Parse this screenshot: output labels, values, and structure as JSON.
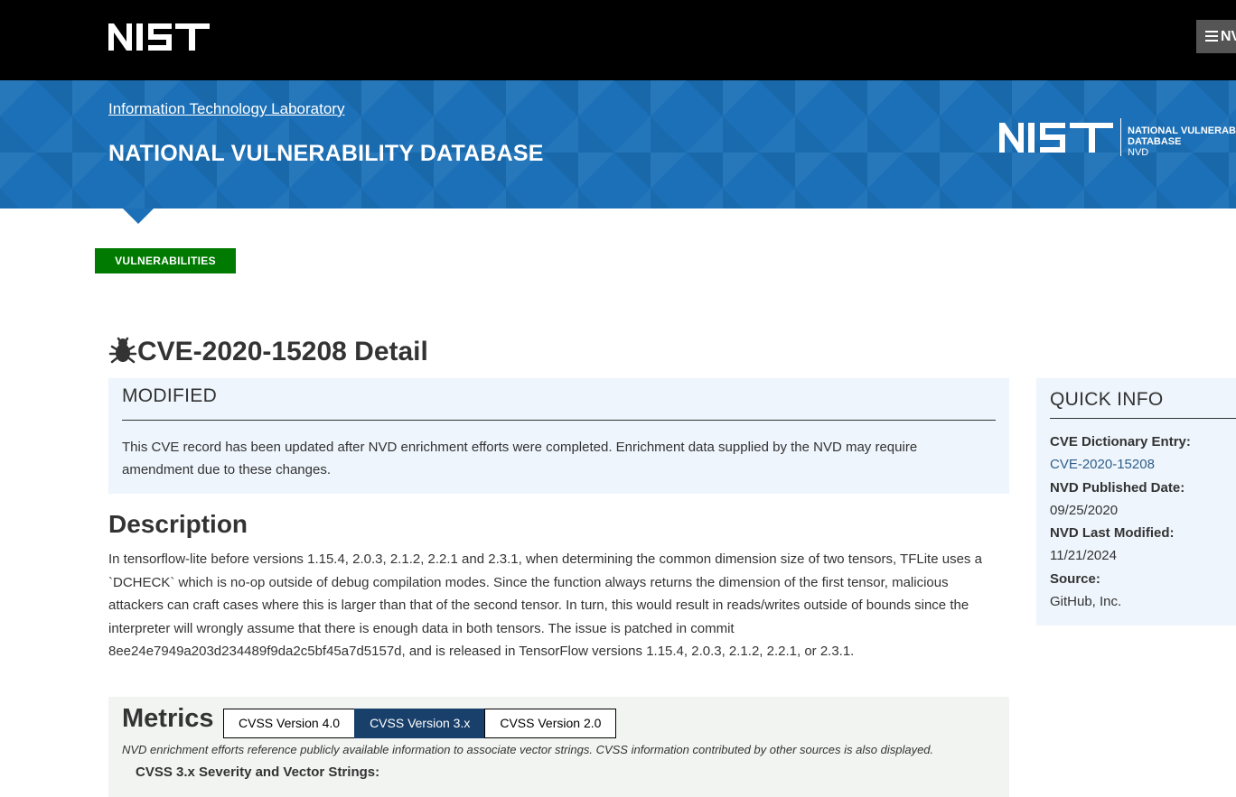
{
  "header": {
    "logo_text": "NIST",
    "menu_label": "NV",
    "menu_icon": "hamburger-icon"
  },
  "banner": {
    "lab_link": "Information Technology Laboratory",
    "title": "NATIONAL VULNERABILITY DATABASE",
    "logo": {
      "mark": "NIST",
      "line1": "NATIONAL VULNERABI",
      "line2": "DATABASE",
      "line3": "NVD"
    }
  },
  "nav": {
    "vulnerabilities_button": "VULNERABILITIES"
  },
  "page": {
    "icon": "bug-icon",
    "title": "CVE-2020-15208 Detail"
  },
  "modified": {
    "title": "MODIFIED",
    "text": "This CVE record has been updated after NVD enrichment efforts were completed. Enrichment data supplied by the NVD may require amendment due to these changes."
  },
  "description": {
    "heading": "Description",
    "text": "In tensorflow-lite before versions 1.15.4, 2.0.3, 2.1.2, 2.2.1 and 2.3.1, when determining the common dimension size of two tensors, TFLite uses a `DCHECK` which is no-op outside of debug compilation modes. Since the function always returns the dimension of the first tensor, malicious attackers can craft cases where this is larger than that of the second tensor. In turn, this would result in reads/writes outside of bounds since the interpreter will wrongly assume that there is enough data in both tensors. The issue is patched in commit 8ee24e7949a203d234489f9da2c5bf45a7d5157d, and is released in TensorFlow versions 1.15.4, 2.0.3, 2.1.2, 2.2.1, or 2.3.1."
  },
  "metrics": {
    "heading": "Metrics",
    "tabs": [
      {
        "label": "CVSS Version 4.0",
        "active": false
      },
      {
        "label": "CVSS Version 3.x",
        "active": true
      },
      {
        "label": "CVSS Version 2.0",
        "active": false
      }
    ],
    "note": "NVD enrichment efforts reference publicly available information to associate vector strings. CVSS information contributed by other sources is also displayed.",
    "subheading": "CVSS 3.x Severity and Vector Strings:"
  },
  "quick_info": {
    "title": "QUICK INFO",
    "items": [
      {
        "label": "CVE Dictionary Entry:",
        "value": "CVE-2020-15208",
        "is_link": true
      },
      {
        "label": "NVD Published Date:",
        "value": "09/25/2020",
        "is_link": false
      },
      {
        "label": "NVD Last Modified:",
        "value": "11/21/2024",
        "is_link": false
      },
      {
        "label": "Source:",
        "value": "GitHub, Inc.",
        "is_link": false
      }
    ]
  },
  "colors": {
    "banner_blue": "#1b70b7",
    "vuln_green": "#007a00",
    "tab_active": "#19406b",
    "info_bg": "#eef5fc",
    "link": "#2f5f8a"
  }
}
